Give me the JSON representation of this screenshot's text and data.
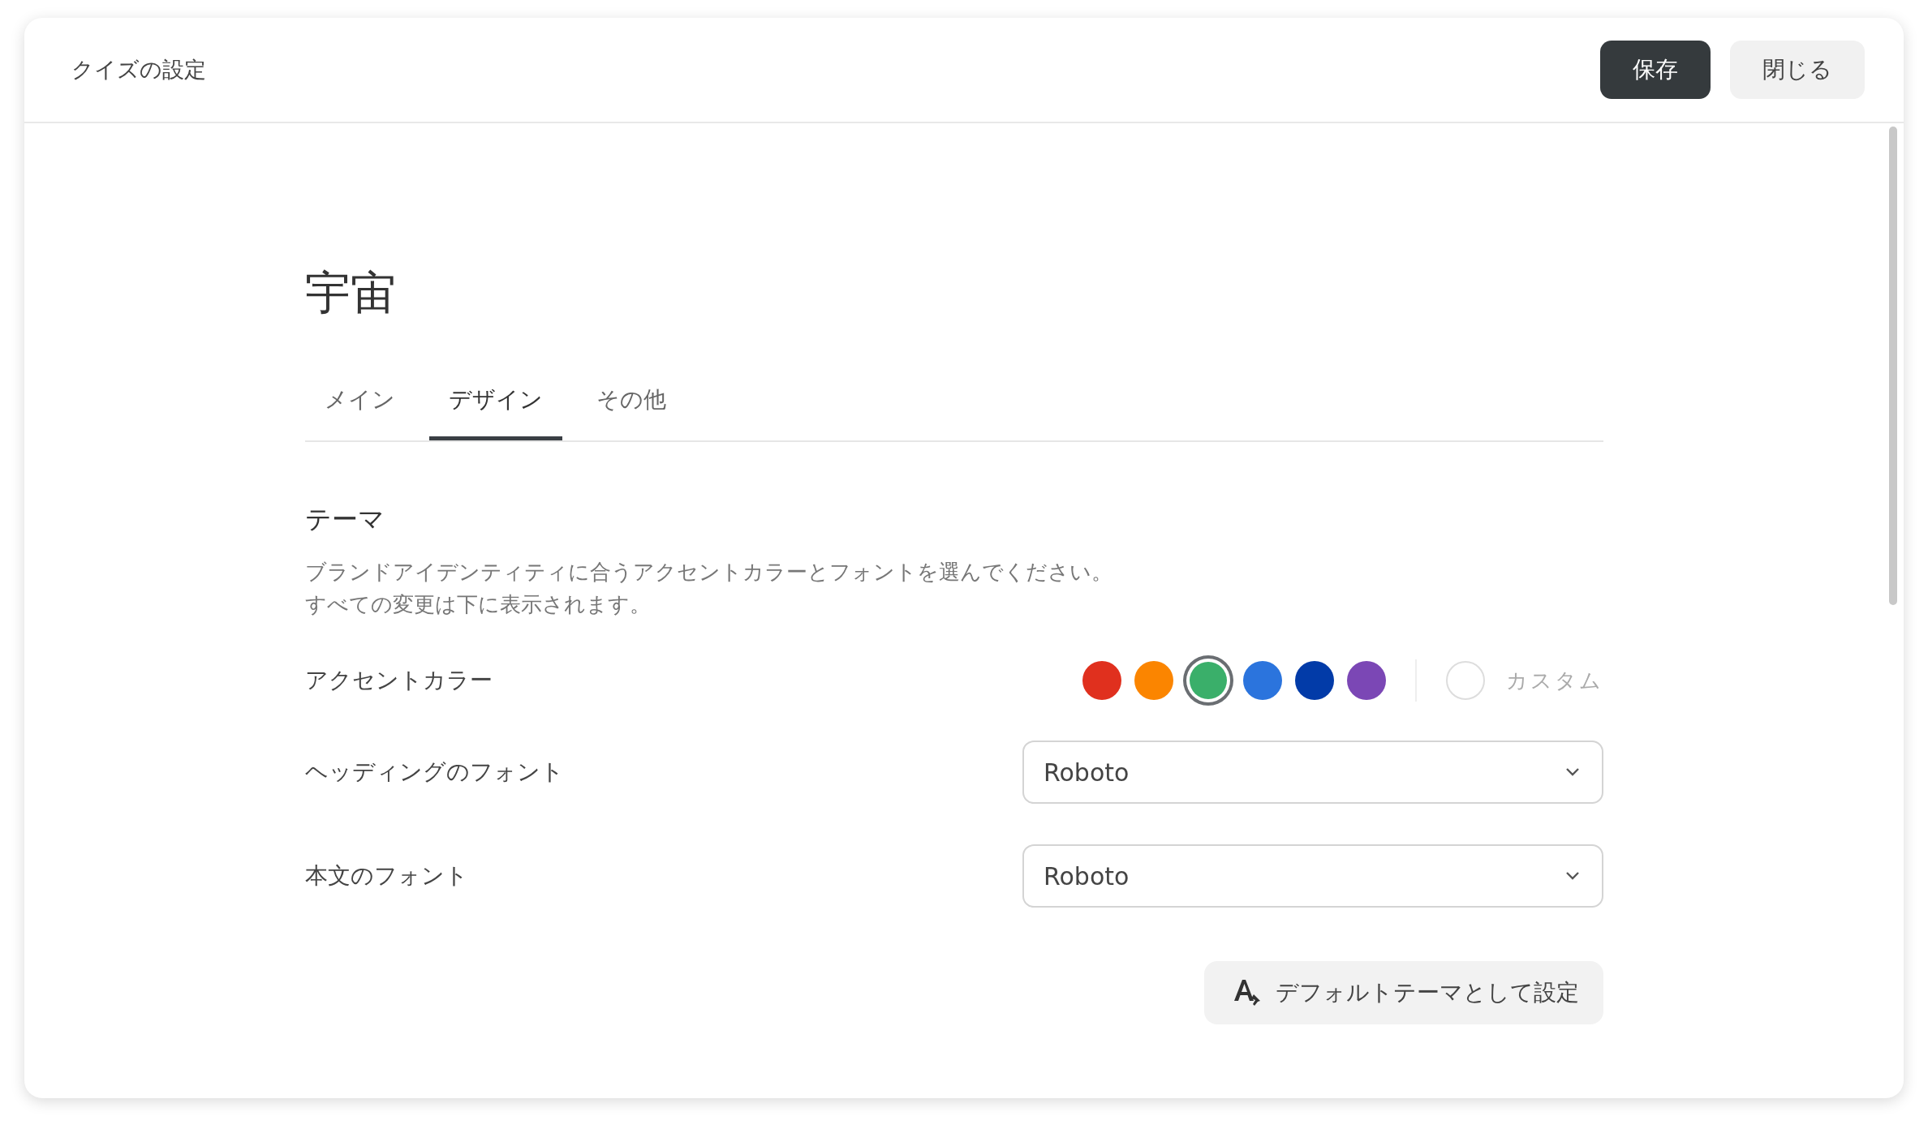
{
  "header": {
    "title": "クイズの設定",
    "buttons": [
      {
        "label": "保存",
        "kind": "primary"
      },
      {
        "label": "閉じる",
        "kind": "secondary"
      }
    ]
  },
  "quiz_title": "宇宙",
  "tabs": [
    {
      "label": "メイン",
      "selected": false
    },
    {
      "label": "デザイン",
      "selected": true
    },
    {
      "label": "その他",
      "selected": false
    }
  ],
  "theme": {
    "heading": "テーマ",
    "description": [
      "ブランドアイデンティティに合うアクセントカラーとフォントを選んでください。",
      "すべての変更は下に表示されます。"
    ],
    "accent": {
      "label": "アクセントカラー",
      "swatches": [
        {
          "color": "#e0301e",
          "selected": false
        },
        {
          "color": "#fb8500",
          "selected": false
        },
        {
          "color": "#3aaf6a",
          "selected": true
        },
        {
          "color": "#2b74dd",
          "selected": false
        },
        {
          "color": "#023ba8",
          "selected": false
        },
        {
          "color": "#7b47b5",
          "selected": false
        }
      ],
      "custom_label": "カスタム"
    },
    "fonts": [
      {
        "label": "ヘッディングのフォント",
        "value": "Roboto"
      },
      {
        "label": "本文のフォント",
        "value": "Roboto"
      }
    ],
    "default_button": "デフォルトテーマとして設定"
  }
}
